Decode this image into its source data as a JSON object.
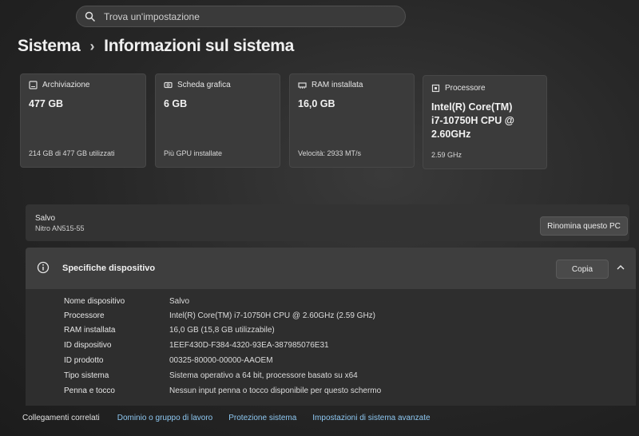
{
  "search": {
    "placeholder": "Trova un'impostazione",
    "icon": "search-icon"
  },
  "breadcrumb": {
    "parent": "Sistema",
    "separator": "›",
    "current": "Informazioni sul sistema"
  },
  "tiles": [
    {
      "icon": "storage-icon",
      "label": "Archiviazione",
      "value": "477 GB",
      "sub": "214 GB di 477 GB utilizzati"
    },
    {
      "icon": "graphics-card-icon",
      "label": "Scheda grafica",
      "value": "6 GB",
      "sub": "Più GPU installate"
    },
    {
      "icon": "ram-icon",
      "label": "RAM installata",
      "value": "16,0 GB",
      "sub": "Velocità: 2933 MT/s"
    },
    {
      "icon": "processor-icon",
      "label": "Processore",
      "value": "Intel(R) Core(TM) i7-10750H CPU @ 2.60GHz",
      "sub": "2.59 GHz"
    }
  ],
  "device": {
    "name": "Salvo",
    "model": "Nitro AN515-55",
    "rename_label": "Rinomina questo PC"
  },
  "specs": {
    "title": "Specifiche dispositivo",
    "copy_label": "Copia",
    "rows": [
      {
        "key": "Nome dispositivo",
        "value": "Salvo"
      },
      {
        "key": "Processore",
        "value": "Intel(R) Core(TM) i7-10750H CPU @ 2.60GHz (2.59 GHz)"
      },
      {
        "key": "RAM installata",
        "value": "16,0 GB (15,8 GB utilizzabile)"
      },
      {
        "key": "ID dispositivo",
        "value": "1EEF430D-F384-4320-93EA-387985076E31"
      },
      {
        "key": "ID prodotto",
        "value": "00325-80000-00000-AAOEM"
      },
      {
        "key": "Tipo sistema",
        "value": "Sistema operativo a 64 bit, processore basato su x64"
      },
      {
        "key": "Penna e tocco",
        "value": "Nessun input penna o tocco disponibile per questo schermo"
      }
    ]
  },
  "related": {
    "label": "Collegamenti correlati",
    "links": [
      "Dominio o gruppo di lavoro",
      "Protezione sistema",
      "Impostazioni di sistema avanzate"
    ]
  },
  "colors": {
    "link": "#8ec8f2",
    "card": "#3b3b3b",
    "background": "#262626"
  }
}
